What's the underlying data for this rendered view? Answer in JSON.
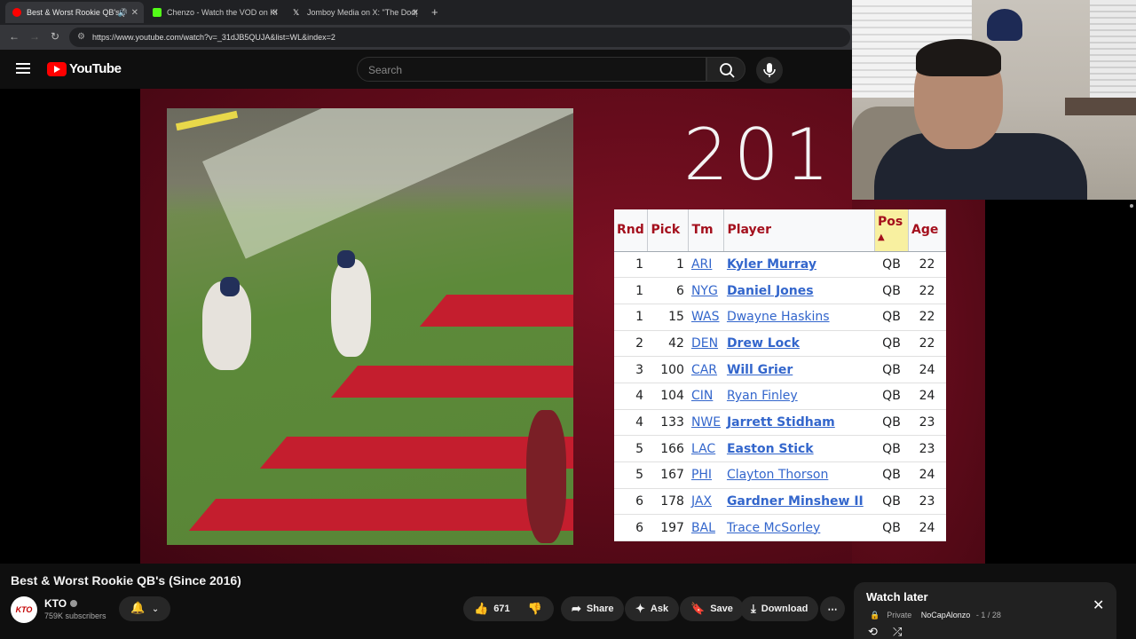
{
  "browser": {
    "tabs": [
      {
        "title": "Best & Worst Rookie QB's (",
        "favicon_color": "#ff0000",
        "active": true
      },
      {
        "title": "Chenzo - Watch the VOD on Ki",
        "favicon_color": "#53fc18",
        "active": false
      },
      {
        "title": "Jomboy Media on X: \"The Dodg",
        "favicon_color": "#ffffff",
        "active": false
      }
    ],
    "url": "https://www.youtube.com/watch?v=_31dJB5QUJA&list=WL&index=2"
  },
  "youtube": {
    "logo_text": "YouTube",
    "search_placeholder": "Search"
  },
  "video": {
    "year_overlay": "201",
    "draft_table": {
      "headers": [
        "Rnd",
        "Pick",
        "Tm",
        "Player",
        "Pos",
        "Age"
      ],
      "sort_indicator": "▲",
      "rows": [
        {
          "rnd": "1",
          "pick": "1",
          "tm": "ARI",
          "player": "Kyler Murray",
          "bold": true,
          "pos": "QB",
          "age": "22"
        },
        {
          "rnd": "1",
          "pick": "6",
          "tm": "NYG",
          "player": "Daniel Jones",
          "bold": true,
          "pos": "QB",
          "age": "22"
        },
        {
          "rnd": "1",
          "pick": "15",
          "tm": "WAS",
          "player": "Dwayne Haskins",
          "bold": false,
          "pos": "QB",
          "age": "22"
        },
        {
          "rnd": "2",
          "pick": "42",
          "tm": "DEN",
          "player": "Drew Lock",
          "bold": true,
          "pos": "QB",
          "age": "22"
        },
        {
          "rnd": "3",
          "pick": "100",
          "tm": "CAR",
          "player": "Will Grier",
          "bold": true,
          "pos": "QB",
          "age": "24"
        },
        {
          "rnd": "4",
          "pick": "104",
          "tm": "CIN",
          "player": "Ryan Finley",
          "bold": false,
          "pos": "QB",
          "age": "24"
        },
        {
          "rnd": "4",
          "pick": "133",
          "tm": "NWE",
          "player": "Jarrett Stidham",
          "bold": true,
          "pos": "QB",
          "age": "23"
        },
        {
          "rnd": "5",
          "pick": "166",
          "tm": "LAC",
          "player": "Easton Stick",
          "bold": true,
          "pos": "QB",
          "age": "23"
        },
        {
          "rnd": "5",
          "pick": "167",
          "tm": "PHI",
          "player": "Clayton Thorson",
          "bold": false,
          "pos": "QB",
          "age": "24"
        },
        {
          "rnd": "6",
          "pick": "178",
          "tm": "JAX",
          "player": "Gardner Minshew II",
          "bold": true,
          "pos": "QB",
          "age": "23"
        },
        {
          "rnd": "6",
          "pick": "197",
          "tm": "BAL",
          "player": "Trace McSorley",
          "bold": false,
          "pos": "QB",
          "age": "24"
        }
      ]
    }
  },
  "meta": {
    "title": "Best & Worst Rookie QB's (Since 2016)",
    "channel": "KTO",
    "channel_avatar_text": "KTO",
    "subscribers": "759K subscribers",
    "likes": "671",
    "share_label": "Share",
    "ask_label": "Ask",
    "save_label": "Save",
    "download_label": "Download"
  },
  "watch_later": {
    "title": "Watch later",
    "privacy": "Private",
    "owner": "NoCapAlonzo",
    "position": "1 / 28"
  }
}
